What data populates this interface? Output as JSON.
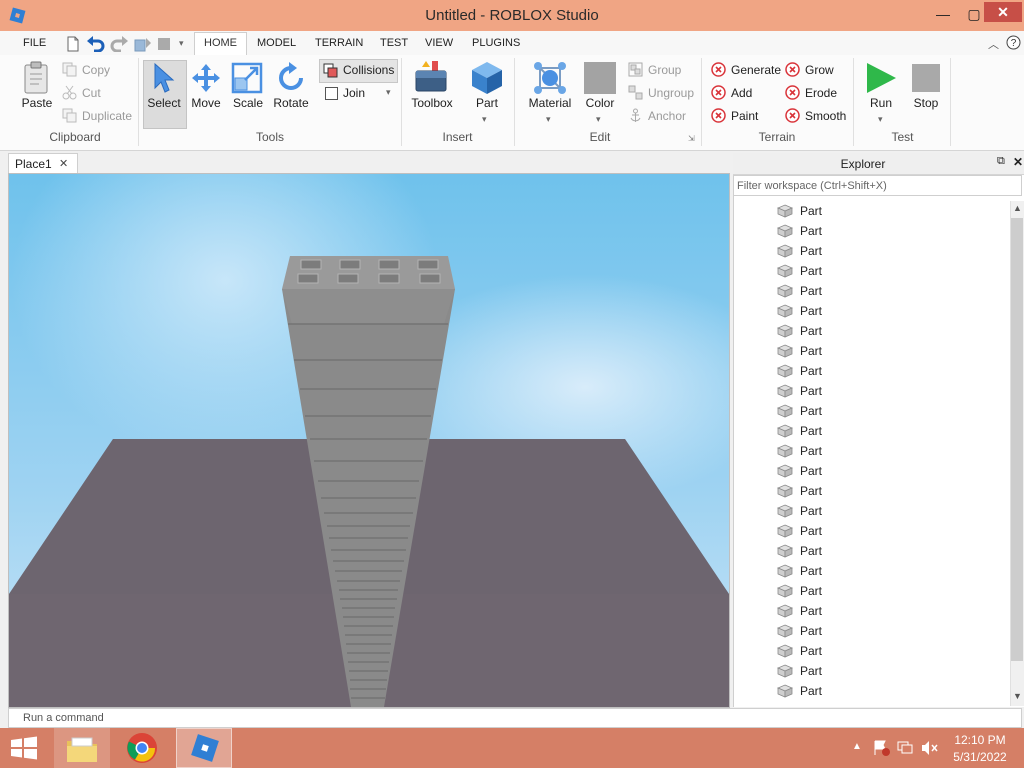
{
  "window": {
    "title": "Untitled - ROBLOX Studio",
    "minimize": "—",
    "maximize": "▢",
    "close": "✕"
  },
  "menu": {
    "tabs": [
      "FILE",
      "HOME",
      "MODEL",
      "TERRAIN",
      "TEST",
      "VIEW",
      "PLUGINS"
    ],
    "active_tab": "HOME"
  },
  "ribbon": {
    "clipboard": {
      "paste": "Paste",
      "copy": "Copy",
      "cut": "Cut",
      "duplicate": "Duplicate",
      "group": "Clipboard"
    },
    "tools": {
      "select": "Select",
      "move": "Move",
      "scale": "Scale",
      "rotate": "Rotate",
      "collisions": "Collisions",
      "join": "Join",
      "group": "Tools"
    },
    "insert": {
      "toolbox": "Toolbox",
      "part": "Part",
      "group": "Insert"
    },
    "edit": {
      "material": "Material",
      "color": "Color",
      "group_btn": "Group",
      "ungroup": "Ungroup",
      "anchor": "Anchor",
      "group": "Edit"
    },
    "terrain": {
      "generate": "Generate",
      "add": "Add",
      "paint": "Paint",
      "grow": "Grow",
      "erode": "Erode",
      "smooth": "Smooth",
      "group": "Terrain"
    },
    "test": {
      "run": "Run",
      "stop": "Stop",
      "group": "Test"
    }
  },
  "document": {
    "tab": "Place1",
    "close": "✕"
  },
  "explorer": {
    "title": "Explorer",
    "filter_placeholder": "Filter workspace (Ctrl+Shift+X)",
    "items": [
      "Part",
      "Part",
      "Part",
      "Part",
      "Part",
      "Part",
      "Part",
      "Part",
      "Part",
      "Part",
      "Part",
      "Part",
      "Part",
      "Part",
      "Part",
      "Part",
      "Part",
      "Part",
      "Part",
      "Part",
      "Part",
      "Part",
      "Part",
      "Part",
      "Part"
    ]
  },
  "command_bar": {
    "placeholder": "Run a command"
  },
  "taskbar": {
    "time": "12:10 PM",
    "date": "5/31/2022"
  },
  "colors": {
    "titlebar": "#f0a584",
    "taskbar": "#d57f66",
    "accent_blue": "#2b7fd6",
    "terrain_red": "#d9343a",
    "run_green": "#2fb84a"
  }
}
